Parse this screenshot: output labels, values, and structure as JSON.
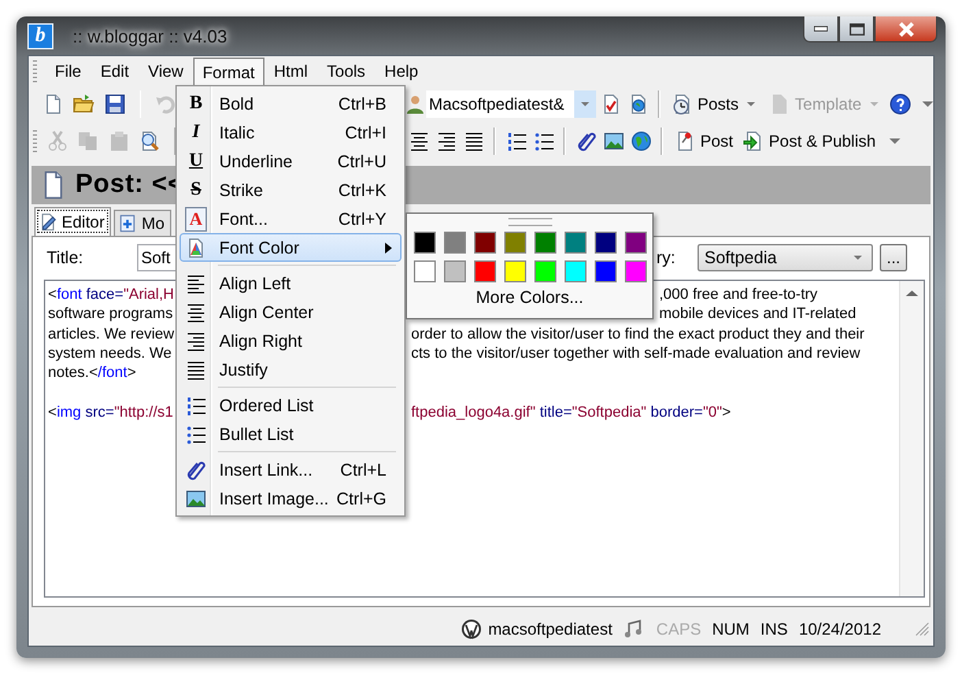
{
  "window": {
    "icon_letter": "b",
    "title": ":: w.bloggar :: v4.03"
  },
  "menu_bar": [
    {
      "label": "File",
      "selected": false
    },
    {
      "label": "Edit",
      "selected": false
    },
    {
      "label": "View",
      "selected": false
    },
    {
      "label": "Format",
      "selected": true
    },
    {
      "label": "Html",
      "selected": false
    },
    {
      "label": "Tools",
      "selected": false
    },
    {
      "label": "Help",
      "selected": false
    }
  ],
  "toolbar_1": {
    "left": [
      {
        "kind": "icon",
        "disabled": false
      },
      {
        "kind": "icon",
        "disabled": false
      },
      {
        "kind": "icon",
        "disabled": false
      },
      {
        "kind": "separator"
      },
      {
        "kind": "icon",
        "disabled": true
      }
    ],
    "right": [
      {
        "kind": "icon",
        "disabled": false
      },
      {
        "kind": "select",
        "value": "Macsoftpediatest&"
      },
      {
        "kind": "icon",
        "disabled": false
      },
      {
        "kind": "icon",
        "disabled": false
      },
      {
        "kind": "separator"
      },
      {
        "kind": "labeled",
        "label": "Posts",
        "dropdown": true,
        "disabled": false
      },
      {
        "kind": "labeled",
        "label": "Template",
        "dropdown": true,
        "disabled": true
      },
      {
        "kind": "icon",
        "disabled": false
      },
      {
        "kind": "icon",
        "disabled": false
      }
    ]
  },
  "toolbar_2": {
    "left": [
      {
        "kind": "icon",
        "disabled": true
      },
      {
        "kind": "icon",
        "disabled": true
      },
      {
        "kind": "icon",
        "disabled": true
      },
      {
        "kind": "icon",
        "disabled": false
      },
      {
        "kind": "separator"
      }
    ],
    "right": [
      {
        "kind": "icon",
        "disabled": false
      },
      {
        "kind": "icon",
        "disabled": false
      },
      {
        "kind": "icon",
        "disabled": false
      },
      {
        "kind": "separator"
      },
      {
        "kind": "icon",
        "disabled": false
      },
      {
        "kind": "icon",
        "disabled": false
      },
      {
        "kind": "separator"
      },
      {
        "kind": "icon",
        "disabled": false
      },
      {
        "kind": "icon",
        "disabled": false
      },
      {
        "kind": "icon",
        "disabled": false
      },
      {
        "kind": "separator"
      },
      {
        "kind": "labeled",
        "label": "Post",
        "dropdown": false,
        "disabled": false
      },
      {
        "kind": "labeled",
        "label": "Post & Publish",
        "dropdown": false,
        "disabled": false
      },
      {
        "kind": "icon",
        "disabled": false
      }
    ]
  },
  "post_header": {
    "title": "Post: <<"
  },
  "tabs": [
    {
      "label": "Editor",
      "selected": true
    },
    {
      "label": "Mo",
      "selected": false
    }
  ],
  "title_field": {
    "label": "Title:",
    "value": "Soft"
  },
  "category": {
    "label": "ry:",
    "value": "Softpedia",
    "browse": "..."
  },
  "editor": {
    "lines": [
      {
        "kind": "code",
        "left": [
          {
            "kind": "punct",
            "text": "<"
          },
          {
            "kind": "tag",
            "text": "font"
          },
          {
            "kind": "attr",
            "text": " face="
          },
          {
            "kind": "value",
            "text": "\"Arial,H"
          }
        ],
        "right": [
          {
            "kind": "text",
            "text": ",000 free and free-to-try"
          }
        ]
      },
      {
        "kind": "code",
        "left": [
          {
            "kind": "text",
            "text": "software programs"
          }
        ],
        "right": [
          {
            "kind": "text",
            "text": "mobile devices and IT-related"
          }
        ]
      },
      {
        "kind": "code",
        "left": [
          {
            "kind": "text",
            "text": "articles. We review"
          }
        ],
        "right": [
          {
            "kind": "text",
            "text": "order to allow the visitor/user to find the exact product they and their"
          }
        ]
      },
      {
        "kind": "code",
        "left": [
          {
            "kind": "text",
            "text": "system needs. We"
          }
        ],
        "right": [
          {
            "kind": "text",
            "text": "cts to the visitor/user together with self-made evaluation and review"
          }
        ]
      },
      {
        "kind": "code",
        "left": [
          {
            "kind": "text",
            "text": "notes."
          },
          {
            "kind": "punct",
            "text": "<"
          },
          {
            "kind": "tag",
            "text": "/font"
          },
          {
            "kind": "punct",
            "text": ">"
          }
        ]
      },
      {
        "kind": "blank"
      },
      {
        "kind": "code",
        "left": [
          {
            "kind": "punct",
            "text": "<"
          },
          {
            "kind": "tag",
            "text": "img"
          },
          {
            "kind": "attr",
            "text": " src="
          },
          {
            "kind": "value",
            "text": "\"http://s1"
          }
        ],
        "right": [
          {
            "kind": "value",
            "text": "ftpedia_logo4a.gif\""
          },
          {
            "kind": "attr",
            "text": " title="
          },
          {
            "kind": "value",
            "text": "\"Softpedia\""
          },
          {
            "kind": "attr",
            "text": " border="
          },
          {
            "kind": "value",
            "text": "\"0\""
          },
          {
            "kind": "punct",
            "text": ">"
          }
        ]
      }
    ]
  },
  "format_menu": {
    "items": [
      {
        "kind": "item",
        "glyph": "B",
        "label": "Bold",
        "shortcut": "Ctrl+B",
        "selected": false
      },
      {
        "kind": "item",
        "glyph": "I",
        "label": "Italic",
        "shortcut": "Ctrl+I",
        "selected": false
      },
      {
        "kind": "item",
        "glyph": "U",
        "label": "Underline",
        "shortcut": "Ctrl+U",
        "selected": false
      },
      {
        "kind": "item",
        "glyph": "S",
        "label": "Strike",
        "shortcut": "Ctrl+K",
        "selected": false
      },
      {
        "kind": "item",
        "glyph": "A",
        "label": "Font...",
        "shortcut": "Ctrl+Y",
        "selected": false
      },
      {
        "kind": "submenu",
        "label": "Font Color",
        "selected": true
      },
      {
        "kind": "separator"
      },
      {
        "kind": "item",
        "label": "Align Left",
        "selected": false
      },
      {
        "kind": "item",
        "label": "Align Center",
        "selected": false
      },
      {
        "kind": "item",
        "label": "Align Right",
        "selected": false
      },
      {
        "kind": "item",
        "label": "Justify",
        "selected": false
      },
      {
        "kind": "separator"
      },
      {
        "kind": "item",
        "label": "Ordered List",
        "selected": false
      },
      {
        "kind": "item",
        "label": "Bullet List",
        "selected": false
      },
      {
        "kind": "separator"
      },
      {
        "kind": "item",
        "label": "Insert Link...",
        "shortcut": "Ctrl+L",
        "selected": false
      },
      {
        "kind": "item",
        "label": "Insert Image...",
        "shortcut": "Ctrl+G",
        "selected": false
      }
    ]
  },
  "color_submenu": {
    "colors": [
      {
        "color": "#000000"
      },
      {
        "color": "#808080"
      },
      {
        "color": "#800000"
      },
      {
        "color": "#808000"
      },
      {
        "color": "#008000"
      },
      {
        "color": "#008080"
      },
      {
        "color": "#000080"
      },
      {
        "color": "#800080"
      },
      {
        "color": "#ffffff"
      },
      {
        "color": "#c0c0c0"
      },
      {
        "color": "#ff0000"
      },
      {
        "color": "#ffff00"
      },
      {
        "color": "#00ff00"
      },
      {
        "color": "#00ffff"
      },
      {
        "color": "#0000ff"
      },
      {
        "color": "#ff00ff"
      }
    ],
    "more": "More Colors..."
  },
  "status_bar": {
    "account": "macsoftpediatest",
    "keys": [
      {
        "label": "CAPS",
        "on": false
      },
      {
        "label": "NUM",
        "on": true
      },
      {
        "label": "INS",
        "on": true
      }
    ],
    "date": "10/24/2012"
  }
}
